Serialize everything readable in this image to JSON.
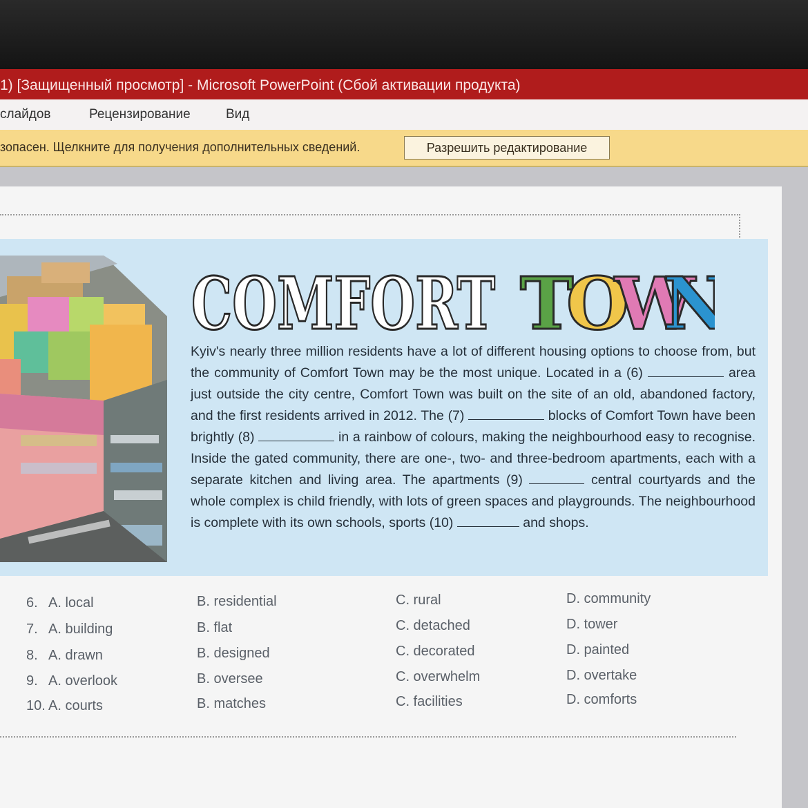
{
  "window": {
    "title": "1) [Защищенный просмотр] - Microsoft PowerPoint (Сбой активации продукта)",
    "accent_color": "#b01c1c"
  },
  "ribbon": {
    "tabs": [
      {
        "label": "слайдов"
      },
      {
        "label": "Рецензирование"
      },
      {
        "label": "Вид"
      }
    ]
  },
  "protected_bar": {
    "message": "зопасен. Щелкните для получения дополнительных сведений.",
    "enable_label": "Разрешить редактирование",
    "color": "#f7d98a"
  },
  "slide": {
    "headline": {
      "word1": "COMFORT",
      "word2_letters": [
        {
          "ch": "T",
          "color": "#5aa246"
        },
        {
          "ch": "O",
          "color": "#f0c64a"
        },
        {
          "ch": "W",
          "color": "#e07ab4"
        },
        {
          "ch": "N",
          "color": "#2b93cf"
        }
      ]
    },
    "passage": [
      "Kyiv's nearly three million residents have a lot of different housing options to choose from, but the community of Comfort Town may be the most unique. Located in a ",
      "(6)",
      " area just outside the city centre, Comfort Town was built on the site of an old, abandoned factory, and the first residents arrived in 2012. The ",
      "(7)",
      " blocks of Comfort Town have been brightly ",
      "(8)",
      " in a rainbow of colours, making the neighbourhood easy to recognise. Inside the gated community, there are one-, two- and three-bedroom apartments, each with a separate kitchen and living area. The apartments ",
      "(9)",
      " central courtyards and the whole complex is child friendly, with lots of green spaces and playgrounds. The neighbourhood is complete with its own schools, sports ",
      "(10)",
      " and shops."
    ],
    "questions": [
      {
        "num": "6.",
        "a": "A. local",
        "b": "B. residential",
        "c": "C. rural",
        "d": "D. community"
      },
      {
        "num": "7.",
        "a": "A. building",
        "b": "B. flat",
        "c": "C. detached",
        "d": "D. tower"
      },
      {
        "num": "8.",
        "a": "A. drawn",
        "b": "B. designed",
        "c": "C. decorated",
        "d": "D. painted"
      },
      {
        "num": "9.",
        "a": "A. overlook",
        "b": "B. oversee",
        "c": "C. overwhelm",
        "d": "D. overtake"
      },
      {
        "num": "10.",
        "a": "A. courts",
        "b": "B. matches",
        "c": "C. facilities",
        "d": "D. comforts"
      }
    ]
  }
}
